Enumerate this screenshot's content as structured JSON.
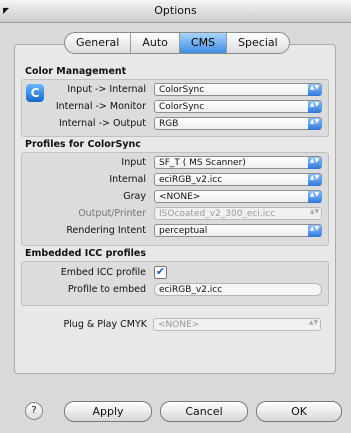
{
  "window": {
    "title": "Options"
  },
  "tabs": [
    {
      "label": "General"
    },
    {
      "label": "Auto"
    },
    {
      "label": "CMS"
    },
    {
      "label": "Special"
    }
  ],
  "color_management": {
    "title": "Color Management",
    "icon_letter": "C",
    "rows": [
      {
        "label": "Input -> Internal",
        "value": "ColorSync"
      },
      {
        "label": "Internal -> Monitor",
        "value": "ColorSync"
      },
      {
        "label": "Internal -> Output",
        "value": "RGB"
      }
    ]
  },
  "profiles": {
    "title": "Profiles for ColorSync",
    "rows": [
      {
        "label": "Input",
        "value": "SF_T ( MS Scanner)"
      },
      {
        "label": "Internal",
        "value": "eciRGB_v2.icc"
      },
      {
        "label": "Gray",
        "value": "<NONE>"
      },
      {
        "label": "Output/Printer",
        "value": "ISOcoated_v2_300_eci.icc"
      },
      {
        "label": "Rendering Intent",
        "value": "perceptual"
      }
    ]
  },
  "embedded": {
    "title": "Embedded ICC profiles",
    "embed_label": "Embed ICC profile",
    "embed_checked": "✔",
    "profile_label": "Profile to embed",
    "profile_value": "eciRGB_v2.icc"
  },
  "plug_play": {
    "label": "Plug & Play CMYK",
    "value": "<NONE>"
  },
  "buttons": {
    "help": "?",
    "apply": "Apply",
    "cancel": "Cancel",
    "ok": "OK"
  },
  "popup_arrow": "▲▼"
}
